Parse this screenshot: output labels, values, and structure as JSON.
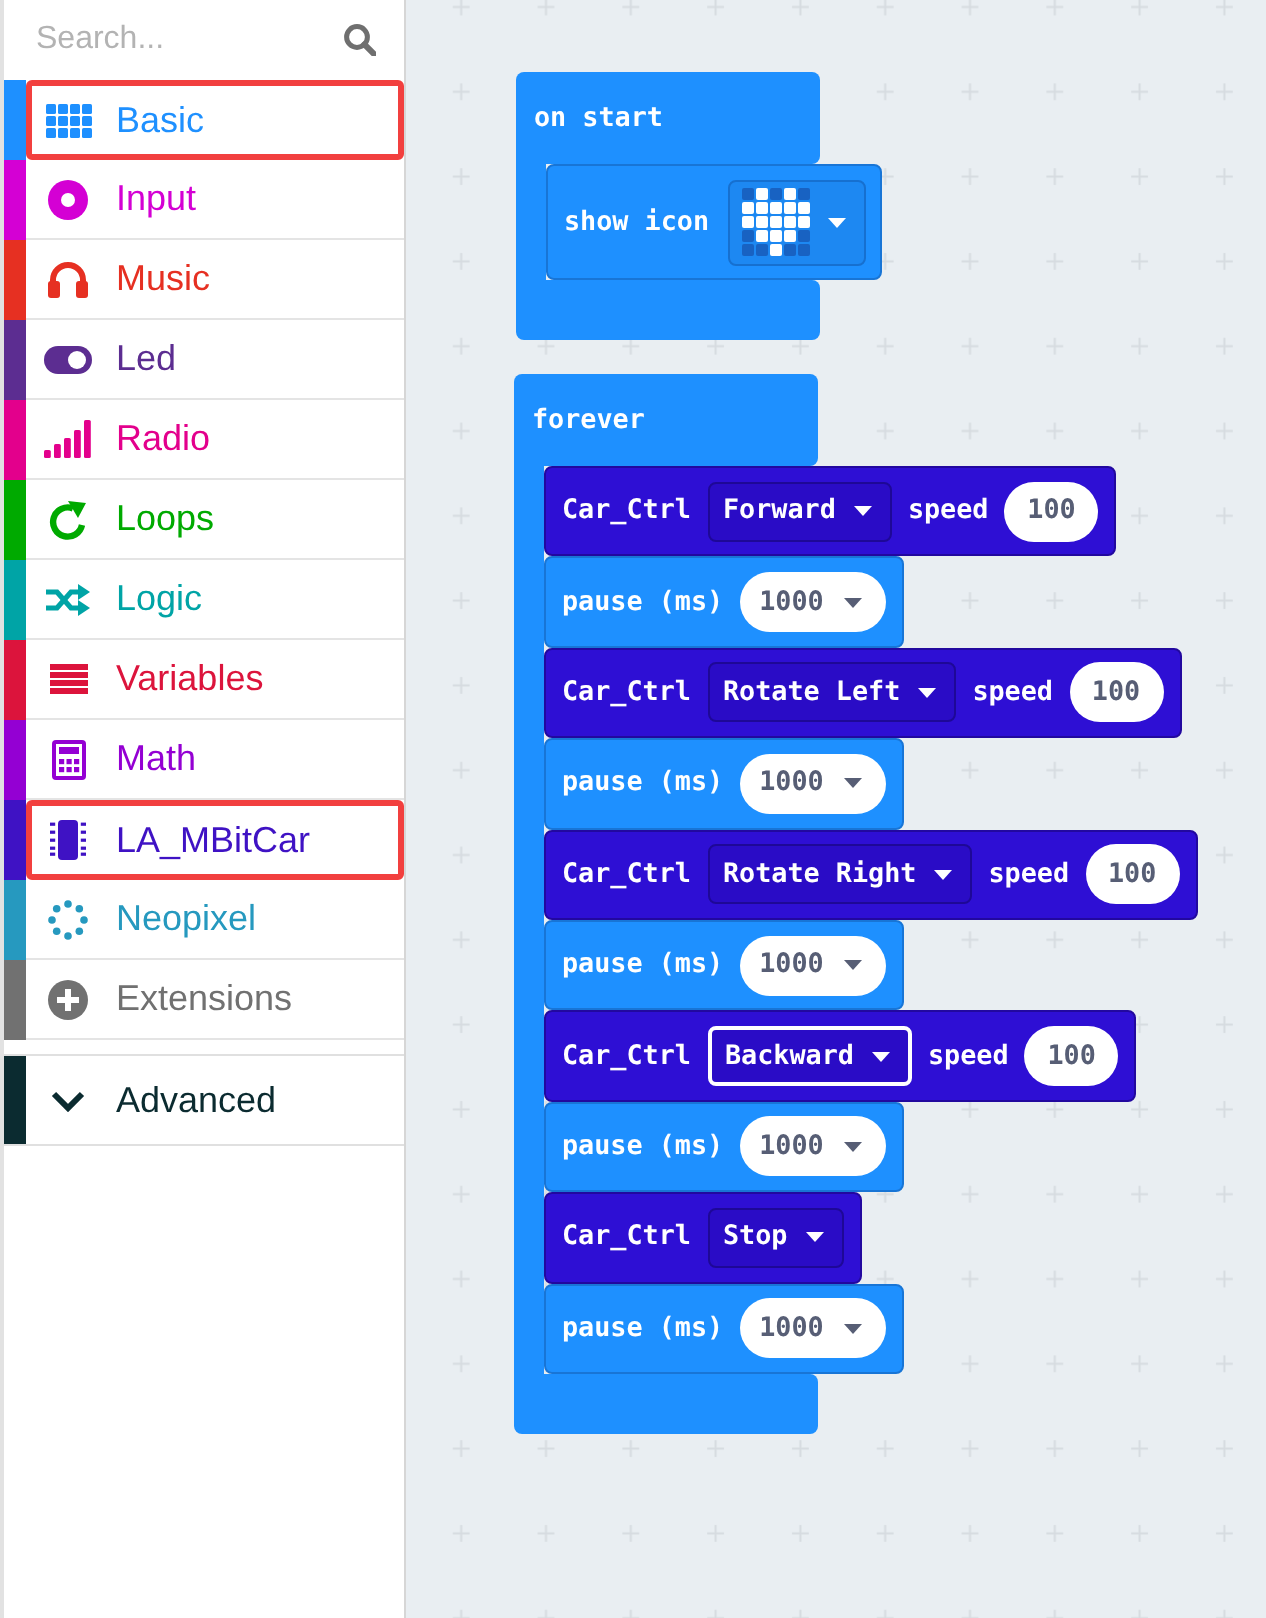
{
  "search": {
    "placeholder": "Search..."
  },
  "categories": [
    {
      "label": "Basic",
      "color": "#1e90ff",
      "highlighted": true
    },
    {
      "label": "Input",
      "color": "#d400d4",
      "highlighted": false
    },
    {
      "label": "Music",
      "color": "#e63022",
      "highlighted": false
    },
    {
      "label": "Led",
      "color": "#5c2d91",
      "highlighted": false
    },
    {
      "label": "Radio",
      "color": "#e3008c",
      "highlighted": false
    },
    {
      "label": "Loops",
      "color": "#00aa00",
      "highlighted": false
    },
    {
      "label": "Logic",
      "color": "#00a4a6",
      "highlighted": false
    },
    {
      "label": "Variables",
      "color": "#dc143c",
      "highlighted": false
    },
    {
      "label": "Math",
      "color": "#9400d3",
      "highlighted": false
    },
    {
      "label": "LA_MBitCar",
      "color": "#3f12c4",
      "highlighted": true
    },
    {
      "label": "Neopixel",
      "color": "#2699bf",
      "highlighted": false
    },
    {
      "label": "Extensions",
      "color": "#717171",
      "highlighted": false
    }
  ],
  "advanced": {
    "label": "Advanced",
    "color": "#0b2b30",
    "expanded": false
  },
  "workspace": {
    "blocks": [
      {
        "kind": "c_block",
        "label": "on start",
        "statements": [
          {
            "kind": "show_icon",
            "label": "show icon",
            "leds": [
              [
                false,
                true,
                false,
                true,
                false
              ],
              [
                true,
                true,
                true,
                true,
                true
              ],
              [
                true,
                true,
                true,
                true,
                true
              ],
              [
                false,
                true,
                true,
                true,
                false
              ],
              [
                false,
                false,
                true,
                false,
                false
              ]
            ]
          }
        ]
      },
      {
        "kind": "c_block",
        "label": "forever",
        "statements": [
          {
            "kind": "car_ctrl",
            "label": "Car_Ctrl",
            "direction": "Forward",
            "focused": false,
            "speed_label": "speed",
            "speed": "100"
          },
          {
            "kind": "pause",
            "label": "pause (ms)",
            "value": "1000"
          },
          {
            "kind": "car_ctrl",
            "label": "Car_Ctrl",
            "direction": "Rotate Left",
            "focused": false,
            "speed_label": "speed",
            "speed": "100"
          },
          {
            "kind": "pause",
            "label": "pause (ms)",
            "value": "1000"
          },
          {
            "kind": "car_ctrl",
            "label": "Car_Ctrl",
            "direction": "Rotate Right",
            "focused": false,
            "speed_label": "speed",
            "speed": "100"
          },
          {
            "kind": "pause",
            "label": "pause (ms)",
            "value": "1000"
          },
          {
            "kind": "car_ctrl",
            "label": "Car_Ctrl",
            "direction": "Backward",
            "focused": true,
            "speed_label": "speed",
            "speed": "100"
          },
          {
            "kind": "pause",
            "label": "pause (ms)",
            "value": "1000"
          },
          {
            "kind": "car_ctrl",
            "label": "Car_Ctrl",
            "direction": "Stop",
            "focused": false
          },
          {
            "kind": "pause",
            "label": "pause (ms)",
            "value": "1000"
          }
        ]
      }
    ]
  }
}
